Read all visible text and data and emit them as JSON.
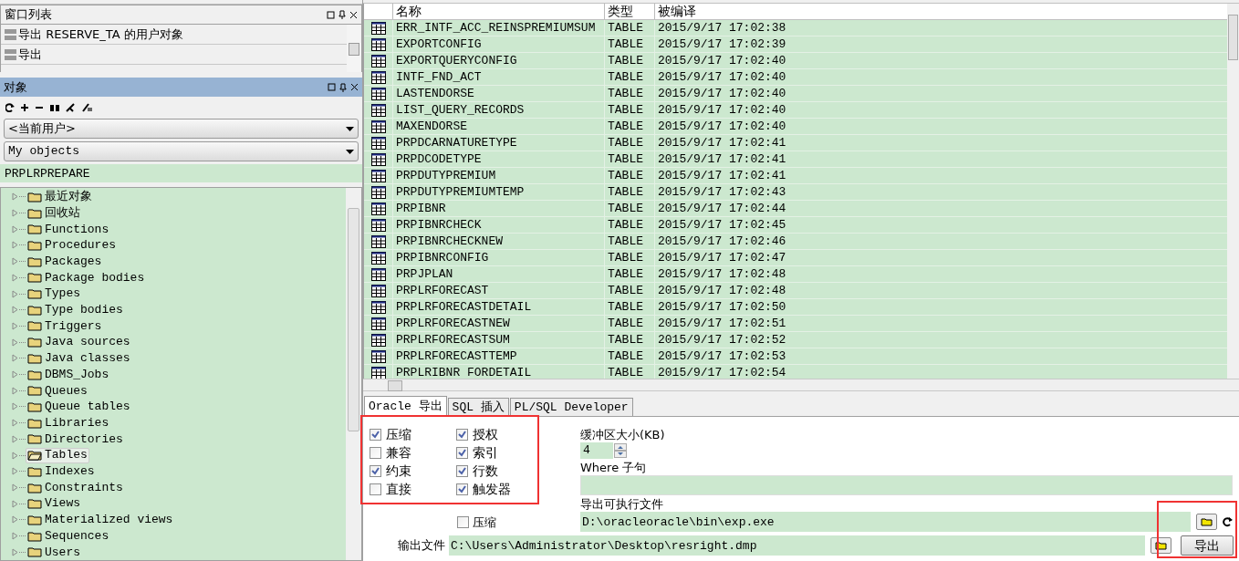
{
  "window_list": {
    "title": "窗口列表",
    "items": [
      {
        "label": "导出 RESERVE_TA 的用户对象"
      },
      {
        "label": "导出"
      }
    ]
  },
  "objects_panel": {
    "title": "对象",
    "user_select": "<当前用户>",
    "filter_select": "My objects",
    "filter_value": "PRPLRPREPARE",
    "tree": [
      {
        "label": "最近对象",
        "selected": false
      },
      {
        "label": "回收站",
        "selected": false
      },
      {
        "label": "Functions",
        "selected": false
      },
      {
        "label": "Procedures",
        "selected": false
      },
      {
        "label": "Packages",
        "selected": false
      },
      {
        "label": "Package bodies",
        "selected": false
      },
      {
        "label": "Types",
        "selected": false
      },
      {
        "label": "Type bodies",
        "selected": false
      },
      {
        "label": "Triggers",
        "selected": false
      },
      {
        "label": "Java sources",
        "selected": false
      },
      {
        "label": "Java classes",
        "selected": false
      },
      {
        "label": "DBMS_Jobs",
        "selected": false
      },
      {
        "label": "Queues",
        "selected": false
      },
      {
        "label": "Queue tables",
        "selected": false
      },
      {
        "label": "Libraries",
        "selected": false
      },
      {
        "label": "Directories",
        "selected": false
      },
      {
        "label": "Tables",
        "selected": true
      },
      {
        "label": "Indexes",
        "selected": false
      },
      {
        "label": "Constraints",
        "selected": false
      },
      {
        "label": "Views",
        "selected": false
      },
      {
        "label": "Materialized views",
        "selected": false
      },
      {
        "label": "Sequences",
        "selected": false
      },
      {
        "label": "Users",
        "selected": false
      }
    ]
  },
  "table": {
    "columns": [
      "名称",
      "类型",
      "被编译"
    ],
    "rows": [
      [
        "ERR_INTF_ACC_REINSPREMIUMSUM",
        "TABLE",
        "2015/9/17 17:02:38"
      ],
      [
        "EXPORTCONFIG",
        "TABLE",
        "2015/9/17 17:02:39"
      ],
      [
        "EXPORTQUERYCONFIG",
        "TABLE",
        "2015/9/17 17:02:40"
      ],
      [
        "INTF_FND_ACT",
        "TABLE",
        "2015/9/17 17:02:40"
      ],
      [
        "LASTENDORSE",
        "TABLE",
        "2015/9/17 17:02:40"
      ],
      [
        "LIST_QUERY_RECORDS",
        "TABLE",
        "2015/9/17 17:02:40"
      ],
      [
        "MAXENDORSE",
        "TABLE",
        "2015/9/17 17:02:40"
      ],
      [
        "PRPDCARNATURETYPE",
        "TABLE",
        "2015/9/17 17:02:41"
      ],
      [
        "PRPDCODETYPE",
        "TABLE",
        "2015/9/17 17:02:41"
      ],
      [
        "PRPDUTYPREMIUM",
        "TABLE",
        "2015/9/17 17:02:41"
      ],
      [
        "PRPDUTYPREMIUMTEMP",
        "TABLE",
        "2015/9/17 17:02:43"
      ],
      [
        "PRPIBNR",
        "TABLE",
        "2015/9/17 17:02:44"
      ],
      [
        "PRPIBNRCHECK",
        "TABLE",
        "2015/9/17 17:02:45"
      ],
      [
        "PRPIBNRCHECKNEW",
        "TABLE",
        "2015/9/17 17:02:46"
      ],
      [
        "PRPIBNRCONFIG",
        "TABLE",
        "2015/9/17 17:02:47"
      ],
      [
        "PRPJPLAN",
        "TABLE",
        "2015/9/17 17:02:48"
      ],
      [
        "PRPLRFORECAST",
        "TABLE",
        "2015/9/17 17:02:48"
      ],
      [
        "PRPLRFORECASTDETAIL",
        "TABLE",
        "2015/9/17 17:02:50"
      ],
      [
        "PRPLRFORECASTNEW",
        "TABLE",
        "2015/9/17 17:02:51"
      ],
      [
        "PRPLRFORECASTSUM",
        "TABLE",
        "2015/9/17 17:02:52"
      ],
      [
        "PRPLRFORECASTTEMP",
        "TABLE",
        "2015/9/17 17:02:53"
      ],
      [
        "PRPLRIBNR FORDETAIL",
        "TABLE",
        "2015/9/17 17:02:54"
      ]
    ]
  },
  "tabs": [
    {
      "label": "Oracle 导出",
      "selected": true
    },
    {
      "label": "SQL 插入",
      "selected": false
    },
    {
      "label": "PL/SQL Developer",
      "selected": false
    }
  ],
  "options": [
    {
      "label": "压缩",
      "checked": true
    },
    {
      "label": "授权",
      "checked": true
    },
    {
      "label": "兼容",
      "checked": false
    },
    {
      "label": "索引",
      "checked": true
    },
    {
      "label": "约束",
      "checked": true
    },
    {
      "label": "行数",
      "checked": true
    },
    {
      "label": "直接",
      "checked": false
    },
    {
      "label": "触发器",
      "checked": true
    }
  ],
  "buffer_size": {
    "label": "缓冲区大小(KB)",
    "value": "4"
  },
  "where_clause": {
    "label": "Where 子句"
  },
  "executable": {
    "label": "导出可执行文件",
    "value": "D:\\oracleoracle\\bin\\exp.exe"
  },
  "compress_output": {
    "label": "压缩",
    "checked": false
  },
  "output_file": {
    "label": "输出文件",
    "value": "C:\\Users\\Administrator\\Desktop\\resright.dmp"
  },
  "export_button": "导出"
}
